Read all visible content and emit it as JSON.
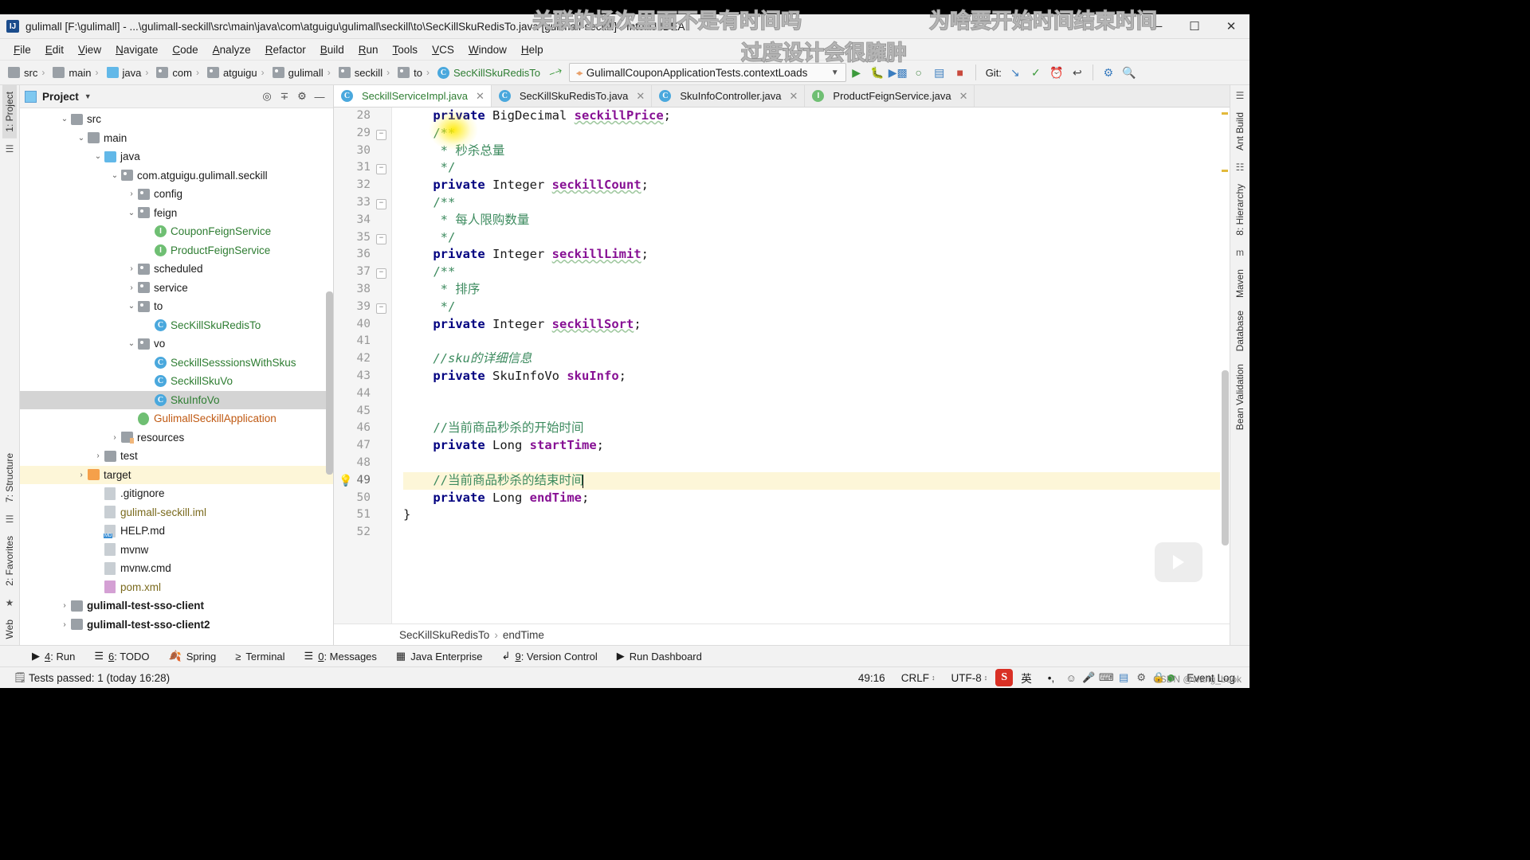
{
  "window": {
    "title": "gulimall [F:\\gulimall] - ...\\gulimall-seckill\\src\\main\\java\\com\\atguigu\\gulimall\\seckill\\to\\SecKillSkuRedisTo.java [gulimall-seckill] - IntelliJ IDEA",
    "app_icon": "IJ",
    "minimize": "─",
    "maximize": "☐",
    "close": "✕"
  },
  "menubar": {
    "items": [
      "File",
      "Edit",
      "View",
      "Navigate",
      "Code",
      "Analyze",
      "Refactor",
      "Build",
      "Run",
      "Tools",
      "VCS",
      "Window",
      "Help"
    ]
  },
  "toolbar": {
    "breadcrumbs": [
      {
        "label": "src",
        "icon": "folder-icon",
        "kind": "folder",
        "color": "dark"
      },
      {
        "label": "main",
        "icon": "folder-icon",
        "kind": "folder",
        "color": "dark"
      },
      {
        "label": "java",
        "icon": "folder-blue-icon",
        "kind": "folder-blue",
        "color": "dark"
      },
      {
        "label": "com",
        "icon": "package-icon",
        "kind": "package",
        "color": "dark"
      },
      {
        "label": "atguigu",
        "icon": "package-icon",
        "kind": "package",
        "color": "dark"
      },
      {
        "label": "gulimall",
        "icon": "package-icon",
        "kind": "package",
        "color": "dark"
      },
      {
        "label": "seckill",
        "icon": "package-icon",
        "kind": "package",
        "color": "dark"
      },
      {
        "label": "to",
        "icon": "package-icon",
        "kind": "package",
        "color": "dark"
      },
      {
        "label": "SecKillSkuRedisTo",
        "icon": "class-icon",
        "kind": "class",
        "color": "green"
      }
    ],
    "build_icon": "hammer-icon",
    "run_config": "GulimallCouponApplicationTests.contextLoads",
    "run_icon": "run-icon",
    "debug_icon": "debug-icon",
    "run_with_coverage_icon": "coverage-icon",
    "profiler_icon": "profiler-icon",
    "stop_icon": "stop-icon",
    "git_label": "Git:",
    "update_project_icon": "update-project-icon",
    "commit_icon": "commit-icon",
    "history_icon": "history-icon",
    "rollback_icon": "rollback-icon",
    "settings_icon": "settings-icon",
    "search_icon": "search-icon"
  },
  "project_panel": {
    "title": "Project",
    "dropdown_icon": "chevron-down-icon",
    "locate_icon": "locate-file-icon",
    "collapse_icon": "collapse-all-icon",
    "settings_icon": "gear-icon",
    "hide_icon": "hide-icon",
    "tree": [
      {
        "label": "src",
        "indent": 2,
        "twist": "⌄",
        "icon": "folder",
        "color": "dark",
        "state": "normal"
      },
      {
        "label": "main",
        "indent": 3,
        "twist": "⌄",
        "icon": "folder",
        "color": "dark",
        "state": "normal"
      },
      {
        "label": "java",
        "indent": 4,
        "twist": "⌄",
        "icon": "folder-blue",
        "color": "dark",
        "state": "normal"
      },
      {
        "label": "com.atguigu.gulimall.seckill",
        "indent": 5,
        "twist": "⌄",
        "icon": "package",
        "color": "dark",
        "state": "normal"
      },
      {
        "label": "config",
        "indent": 6,
        "twist": "›",
        "icon": "package",
        "color": "dark",
        "state": "normal"
      },
      {
        "label": "feign",
        "indent": 6,
        "twist": "⌄",
        "icon": "package",
        "color": "dark",
        "state": "normal"
      },
      {
        "label": "CouponFeignService",
        "indent": 7,
        "twist": "",
        "icon": "interface",
        "color": "green",
        "state": "normal"
      },
      {
        "label": "ProductFeignService",
        "indent": 7,
        "twist": "",
        "icon": "interface",
        "color": "green",
        "state": "normal"
      },
      {
        "label": "scheduled",
        "indent": 6,
        "twist": "›",
        "icon": "package",
        "color": "dark",
        "state": "normal"
      },
      {
        "label": "service",
        "indent": 6,
        "twist": "›",
        "icon": "package",
        "color": "dark",
        "state": "normal"
      },
      {
        "label": "to",
        "indent": 6,
        "twist": "⌄",
        "icon": "package",
        "color": "dark",
        "state": "normal"
      },
      {
        "label": "SecKillSkuRedisTo",
        "indent": 7,
        "twist": "",
        "icon": "class",
        "color": "green",
        "state": "normal"
      },
      {
        "label": "vo",
        "indent": 6,
        "twist": "⌄",
        "icon": "package",
        "color": "dark",
        "state": "normal"
      },
      {
        "label": "SeckillSesssionsWithSkus",
        "indent": 7,
        "twist": "",
        "icon": "class",
        "color": "green",
        "state": "normal"
      },
      {
        "label": "SeckillSkuVo",
        "indent": 7,
        "twist": "",
        "icon": "class",
        "color": "green",
        "state": "normal"
      },
      {
        "label": "SkuInfoVo",
        "indent": 7,
        "twist": "",
        "icon": "class",
        "color": "green",
        "state": "selected"
      },
      {
        "label": "GulimallSeckillApplication",
        "indent": 6,
        "twist": "",
        "icon": "spring-app",
        "color": "orange",
        "state": "normal"
      },
      {
        "label": "resources",
        "indent": 5,
        "twist": "›",
        "icon": "folder-res",
        "color": "dark",
        "state": "normal"
      },
      {
        "label": "test",
        "indent": 4,
        "twist": "›",
        "icon": "folder",
        "color": "dark",
        "state": "normal"
      },
      {
        "label": "target",
        "indent": 3,
        "twist": "›",
        "icon": "folder-orange",
        "color": "dark",
        "state": "highlight"
      },
      {
        "label": ".gitignore",
        "indent": 4,
        "twist": "",
        "icon": "file",
        "color": "dark",
        "state": "normal"
      },
      {
        "label": "gulimall-seckill.iml",
        "indent": 4,
        "twist": "",
        "icon": "file-iml",
        "color": "olive",
        "state": "normal"
      },
      {
        "label": "HELP.md",
        "indent": 4,
        "twist": "",
        "icon": "file-md",
        "color": "dark",
        "state": "normal"
      },
      {
        "label": "mvnw",
        "indent": 4,
        "twist": "",
        "icon": "file",
        "color": "dark",
        "state": "normal"
      },
      {
        "label": "mvnw.cmd",
        "indent": 4,
        "twist": "",
        "icon": "file",
        "color": "dark",
        "state": "normal"
      },
      {
        "label": "pom.xml",
        "indent": 4,
        "twist": "",
        "icon": "file-xml",
        "color": "olive",
        "state": "normal"
      },
      {
        "label": "gulimall-test-sso-client",
        "indent": 2,
        "twist": "›",
        "icon": "folder",
        "color": "dark",
        "state": "bold"
      },
      {
        "label": "gulimall-test-sso-client2",
        "indent": 2,
        "twist": "›",
        "icon": "folder",
        "color": "dark",
        "state": "bold"
      }
    ]
  },
  "left_strip": {
    "tabs": [
      "1: Project",
      "7: Structure",
      "2: Favorites",
      "Web"
    ]
  },
  "right_strip": {
    "tabs": [
      "Ant Build",
      "8: Hierarchy",
      "Maven",
      "Database",
      "Bean Validation"
    ]
  },
  "editor": {
    "tabs": [
      {
        "label": "SeckillServiceImpl.java",
        "icon": "class-icon",
        "color": "green",
        "active": true
      },
      {
        "label": "SecKillSkuRedisTo.java",
        "icon": "class-icon",
        "color": "dark",
        "active": false
      },
      {
        "label": "SkuInfoController.java",
        "icon": "class-icon",
        "color": "dark",
        "active": false
      },
      {
        "label": "ProductFeignService.java",
        "icon": "interface-icon",
        "color": "dark",
        "active": false
      }
    ],
    "first_line": 28,
    "lines": [
      {
        "n": 28,
        "fold": false,
        "bulb": false,
        "hl": false,
        "tokens": [
          {
            "t": "    ",
            "c": "pun"
          },
          {
            "t": "private",
            "c": "kw"
          },
          {
            "t": " ",
            "c": "pun"
          },
          {
            "t": "BigDecimal",
            "c": "typ"
          },
          {
            "t": " ",
            "c": "pun"
          },
          {
            "t": "seckillPrice",
            "c": "fld-wav"
          },
          {
            "t": ";",
            "c": "pun"
          }
        ]
      },
      {
        "n": 29,
        "fold": true,
        "bulb": false,
        "hl": false,
        "tokens": [
          {
            "t": "    /**",
            "c": "cmt"
          }
        ]
      },
      {
        "n": 30,
        "fold": false,
        "bulb": false,
        "hl": false,
        "tokens": [
          {
            "t": "     * 秒杀总量",
            "c": "cmt"
          }
        ]
      },
      {
        "n": 31,
        "fold": true,
        "bulb": false,
        "hl": false,
        "tokens": [
          {
            "t": "     */",
            "c": "cmt"
          }
        ]
      },
      {
        "n": 32,
        "fold": false,
        "bulb": false,
        "hl": false,
        "tokens": [
          {
            "t": "    ",
            "c": "pun"
          },
          {
            "t": "private",
            "c": "kw"
          },
          {
            "t": " ",
            "c": "pun"
          },
          {
            "t": "Integer",
            "c": "typ"
          },
          {
            "t": " ",
            "c": "pun"
          },
          {
            "t": "seckillCount",
            "c": "fld-wav"
          },
          {
            "t": ";",
            "c": "pun"
          }
        ]
      },
      {
        "n": 33,
        "fold": true,
        "bulb": false,
        "hl": false,
        "tokens": [
          {
            "t": "    /**",
            "c": "cmt"
          }
        ]
      },
      {
        "n": 34,
        "fold": false,
        "bulb": false,
        "hl": false,
        "tokens": [
          {
            "t": "     * 每人限购数量",
            "c": "cmt"
          }
        ]
      },
      {
        "n": 35,
        "fold": true,
        "bulb": false,
        "hl": false,
        "tokens": [
          {
            "t": "     */",
            "c": "cmt"
          }
        ]
      },
      {
        "n": 36,
        "fold": false,
        "bulb": false,
        "hl": false,
        "tokens": [
          {
            "t": "    ",
            "c": "pun"
          },
          {
            "t": "private",
            "c": "kw"
          },
          {
            "t": " ",
            "c": "pun"
          },
          {
            "t": "Integer",
            "c": "typ"
          },
          {
            "t": " ",
            "c": "pun"
          },
          {
            "t": "seckillLimit",
            "c": "fld-wav"
          },
          {
            "t": ";",
            "c": "pun"
          }
        ]
      },
      {
        "n": 37,
        "fold": true,
        "bulb": false,
        "hl": false,
        "tokens": [
          {
            "t": "    /**",
            "c": "cmt"
          }
        ]
      },
      {
        "n": 38,
        "fold": false,
        "bulb": false,
        "hl": false,
        "tokens": [
          {
            "t": "     * 排序",
            "c": "cmt"
          }
        ]
      },
      {
        "n": 39,
        "fold": true,
        "bulb": false,
        "hl": false,
        "tokens": [
          {
            "t": "     */",
            "c": "cmt"
          }
        ]
      },
      {
        "n": 40,
        "fold": false,
        "bulb": false,
        "hl": false,
        "tokens": [
          {
            "t": "    ",
            "c": "pun"
          },
          {
            "t": "private",
            "c": "kw"
          },
          {
            "t": " ",
            "c": "pun"
          },
          {
            "t": "Integer",
            "c": "typ"
          },
          {
            "t": " ",
            "c": "pun"
          },
          {
            "t": "seckillSort",
            "c": "fld-wav"
          },
          {
            "t": ";",
            "c": "pun"
          }
        ]
      },
      {
        "n": 41,
        "fold": false,
        "bulb": false,
        "hl": false,
        "tokens": []
      },
      {
        "n": 42,
        "fold": false,
        "bulb": false,
        "hl": false,
        "tokens": [
          {
            "t": "    //sku的详细信息",
            "c": "cmt-i"
          }
        ]
      },
      {
        "n": 43,
        "fold": false,
        "bulb": false,
        "hl": false,
        "tokens": [
          {
            "t": "    ",
            "c": "pun"
          },
          {
            "t": "private",
            "c": "kw"
          },
          {
            "t": " ",
            "c": "pun"
          },
          {
            "t": "SkuInfoVo",
            "c": "typ"
          },
          {
            "t": " ",
            "c": "pun"
          },
          {
            "t": "skuInfo",
            "c": "fld"
          },
          {
            "t": ";",
            "c": "pun"
          }
        ]
      },
      {
        "n": 44,
        "fold": false,
        "bulb": false,
        "hl": false,
        "tokens": []
      },
      {
        "n": 45,
        "fold": false,
        "bulb": false,
        "hl": false,
        "tokens": []
      },
      {
        "n": 46,
        "fold": false,
        "bulb": false,
        "hl": false,
        "tokens": [
          {
            "t": "    //当前商品秒杀的开始时间",
            "c": "cmt"
          }
        ]
      },
      {
        "n": 47,
        "fold": false,
        "bulb": false,
        "hl": false,
        "tokens": [
          {
            "t": "    ",
            "c": "pun"
          },
          {
            "t": "private",
            "c": "kw"
          },
          {
            "t": " ",
            "c": "pun"
          },
          {
            "t": "Long",
            "c": "typ"
          },
          {
            "t": " ",
            "c": "pun"
          },
          {
            "t": "startTime",
            "c": "fld"
          },
          {
            "t": ";",
            "c": "pun"
          }
        ]
      },
      {
        "n": 48,
        "fold": false,
        "bulb": false,
        "hl": false,
        "tokens": []
      },
      {
        "n": 49,
        "fold": false,
        "bulb": true,
        "hl": true,
        "tokens": [
          {
            "t": "    //当前商品秒杀的结束时间",
            "c": "cmt"
          }
        ]
      },
      {
        "n": 50,
        "fold": false,
        "bulb": false,
        "hl": false,
        "tokens": [
          {
            "t": "    ",
            "c": "pun"
          },
          {
            "t": "private",
            "c": "kw"
          },
          {
            "t": " ",
            "c": "pun"
          },
          {
            "t": "Long",
            "c": "typ"
          },
          {
            "t": " ",
            "c": "pun"
          },
          {
            "t": "endTime",
            "c": "fld"
          },
          {
            "t": ";",
            "c": "pun"
          }
        ]
      },
      {
        "n": 51,
        "fold": false,
        "bulb": false,
        "hl": false,
        "tokens": [
          {
            "t": "}",
            "c": "pun"
          }
        ]
      },
      {
        "n": 52,
        "fold": false,
        "bulb": false,
        "hl": false,
        "tokens": []
      }
    ],
    "breadcrumb": [
      "SecKillSkuRedisTo",
      "endTime"
    ],
    "breadcrumb_sep": "›"
  },
  "bottom_toolwindows": [
    {
      "num": "4",
      "label": "Run",
      "icon": "run-triangle-icon"
    },
    {
      "num": "6",
      "label": "TODO",
      "icon": "todo-list-icon"
    },
    {
      "num": "",
      "label": "Spring",
      "icon": "spring-leaf-icon"
    },
    {
      "num": "",
      "label": "Terminal",
      "icon": "terminal-icon"
    },
    {
      "num": "0",
      "label": "Messages",
      "icon": "messages-icon"
    },
    {
      "num": "",
      "label": "Java Enterprise",
      "icon": "java-enterprise-icon"
    },
    {
      "num": "9",
      "label": "Version Control",
      "icon": "version-control-icon"
    },
    {
      "num": "",
      "label": "Run Dashboard",
      "icon": "run-dashboard-icon"
    }
  ],
  "statusbar": {
    "message_icon": "notification-icon",
    "message": "Tests passed: 1 (today 16:28)",
    "caret_position": "49:16",
    "line_separator": "CRLF",
    "encoding": "UTF-8",
    "ime_badge": "S",
    "ime_lang": "英",
    "ime_punct": "•,",
    "ime_emoji": "☺",
    "mic_icon": "microphone-icon",
    "keyboard_icon": "keyboard-icon",
    "toolbox_icon": "toolbox-icon",
    "gear_icon": "gear-icon",
    "lock_icon": "lock-icon",
    "event_log": "Event Log",
    "event_log_icon": "event-log-icon"
  },
  "overlays": {
    "line1": "关联的场次里面不是有时间吗",
    "line2": "为啥要开始时间结束时间",
    "line3": "过度设计会很臃肿"
  },
  "watermark": "CSDN @wang_book"
}
